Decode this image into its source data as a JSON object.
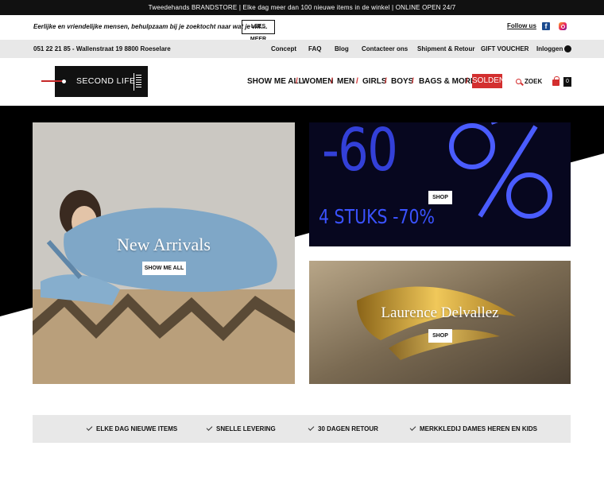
{
  "announcement": "Tweedehands BRANDSTORE | Elke dag meer dan 100 nieuwe items in de winkel | ONLINE OPEN 24/7",
  "promo": {
    "tagline": "Eerlijke en vriendelijke mensen, behulpzaam bij je zoektocht naar wat je wil....",
    "read_more": "LEES MEER",
    "follow_us": "Follow us",
    "facebook_icon": "facebook-icon",
    "instagram_icon": "instagram-icon"
  },
  "info": {
    "address": "051 22 21 85 - Wallenstraat 19 8800 Roeselare",
    "links": [
      "Concept",
      "FAQ",
      "Blog",
      "Contacteer ons",
      "Shipment & Retour",
      "GIFT VOUCHER",
      "Inloggen"
    ]
  },
  "logo": {
    "text": "SECOND LIFE"
  },
  "nav": {
    "items": [
      "SHOW ME ALL",
      "WOMEN",
      "MEN",
      "GIRLS",
      "BOYS",
      "BAGS & MORE"
    ],
    "sale": "SOLDEN",
    "search": "ZOEK",
    "cart_count": "0",
    "accent": "#d32f2f"
  },
  "tiles": {
    "new_arrivals": {
      "title": "New Arrivals",
      "button": "SHOW ME ALL"
    },
    "sale": {
      "big": "-60",
      "sub": "4 STUKS -70%",
      "button": "SHOP",
      "neon": "#4a5cff"
    },
    "designer": {
      "title": "Laurence Delvallez",
      "button": "SHOP"
    }
  },
  "features": [
    "ELKE DAG NIEUWE ITEMS",
    "SNELLE LEVERING",
    "30 DAGEN RETOUR",
    "MERKKLEDIJ DAMES HEREN EN KIDS"
  ]
}
